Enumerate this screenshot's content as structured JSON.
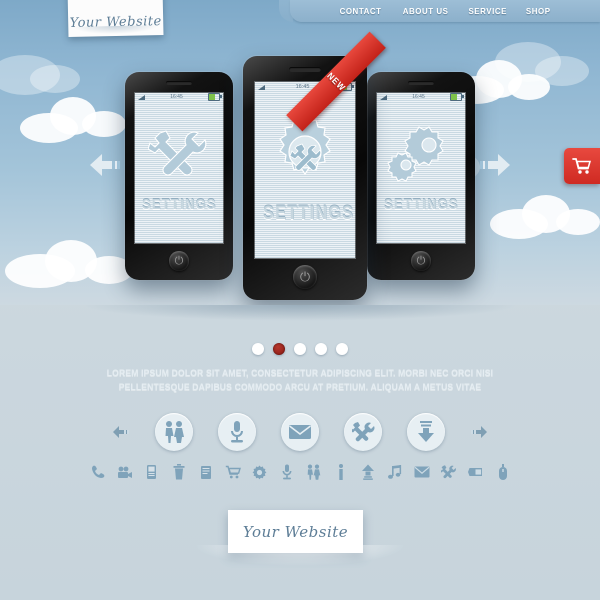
{
  "nav": {
    "items": [
      {
        "label": "CONTACT",
        "name": "nav-contact"
      },
      {
        "label": "ABOUT US",
        "name": "nav-aboutus"
      },
      {
        "label": "SERVICE",
        "name": "nav-service"
      },
      {
        "label": "SHOP",
        "name": "nav-shop"
      }
    ]
  },
  "logo": {
    "top_note": "Your Website",
    "bottom_note": "Your Website"
  },
  "hero": {
    "prev_arrow_icon": "arrow-left-icon",
    "next_arrow_icon": "arrow-right-icon",
    "cart_icon": "shopping-cart-icon",
    "ribbon_label": "NEW",
    "phones": [
      {
        "name": "phone-left",
        "screen_label": "SETTINGS",
        "status_time": "16:45",
        "art_icon": "tools-icon"
      },
      {
        "name": "phone-center",
        "screen_label": "SETTINGS",
        "status_time": "16:45",
        "art_icon": "gear-icon"
      },
      {
        "name": "phone-right",
        "screen_label": "SETTINGS",
        "status_time": "16:45",
        "art_icon": "gears-icon"
      }
    ]
  },
  "slider": {
    "dots": [
      {
        "active": false
      },
      {
        "active": true
      },
      {
        "active": false
      },
      {
        "active": false
      },
      {
        "active": false
      }
    ]
  },
  "content": {
    "line1": "LOREM IPSUM DOLOR SIT AMET, CONSECTETUR ADIPISCING ELIT. MORBI NEC ORCI NISI",
    "line2": "PELLENTESQUE DAPIBUS COMMODO ARCU AT PRETIUM. ALIQUAM A METUS VITAE"
  },
  "feature_icons": {
    "prev_icon": "arrow-left-icon",
    "next_icon": "arrow-right-icon",
    "items": [
      {
        "icon": "people-icon"
      },
      {
        "icon": "microphone-icon"
      },
      {
        "icon": "envelope-icon"
      },
      {
        "icon": "tools-icon"
      },
      {
        "icon": "download-icon"
      }
    ]
  },
  "small_icons": [
    {
      "icon": "phone-icon"
    },
    {
      "icon": "video-camera-icon"
    },
    {
      "icon": "mobile-phone-icon"
    },
    {
      "icon": "trash-icon"
    },
    {
      "icon": "notebook-icon"
    },
    {
      "icon": "shopping-cart-icon"
    },
    {
      "icon": "gear-icon"
    },
    {
      "icon": "microphone-icon"
    },
    {
      "icon": "people-icon"
    },
    {
      "icon": "info-icon"
    },
    {
      "icon": "upload-icon"
    },
    {
      "icon": "music-note-icon"
    },
    {
      "icon": "envelope-icon"
    },
    {
      "icon": "tools-icon"
    },
    {
      "icon": "battery-icon"
    },
    {
      "icon": "mouse-icon"
    }
  ],
  "colors": {
    "sky_top": "#7ea9c8",
    "sky_bottom": "#cdd9e1",
    "body_bg": "#ccd8df",
    "accent_red": "#cf2a22",
    "icon_blue": "#7fa3ba",
    "nav_bar": "#8cb0cb"
  }
}
